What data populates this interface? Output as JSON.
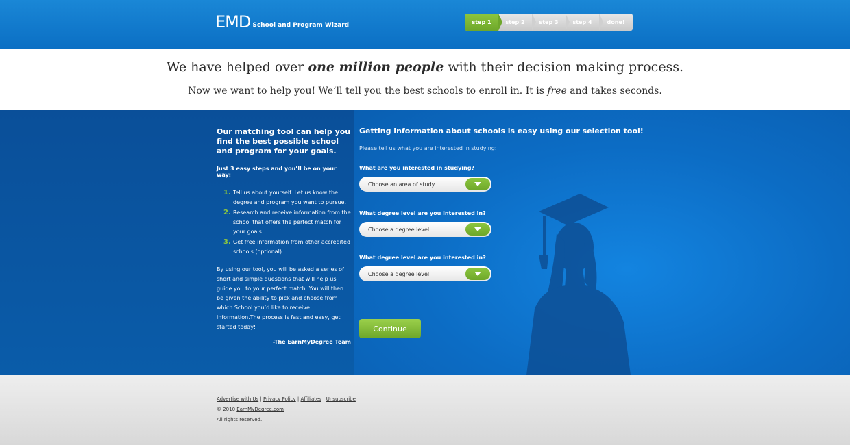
{
  "header": {
    "logo_mark": "EMD",
    "logo_subtitle": "School and Program Wizard",
    "steps": [
      "step 1",
      "step 2",
      "step 3",
      "step 4",
      "done!"
    ],
    "active_step": 1
  },
  "hero": {
    "line1_prefix": "We have helped over ",
    "line1_emph": "one million people",
    "line1_suffix": " with their decision making process.",
    "line2_prefix": "Now we want to help you! We’ll tell you the best schools to enroll in. It is ",
    "line2_emph": "free",
    "line2_suffix": " and takes seconds."
  },
  "left": {
    "heading": "Our matching tool can help you find the best possible school and program for your goals.",
    "subheading": "Just 3 easy steps and you’ll be on your way:",
    "steps": [
      {
        "num": "1.",
        "text": "Tell us about yourself. Let us know the degree and program you want to pursue."
      },
      {
        "num": "2.",
        "text": "Research and receive information from the school that offers the perfect match for your goals."
      },
      {
        "num": "3.",
        "text": "Get free information from other accredited schools (optional)."
      }
    ],
    "body": "By using our tool, you will be asked a series of short and simple questions that will help us guide you to your perfect match. You will then be given the ability to pick and choose from which School you’d like to receive information.The process is fast and easy, get started today!",
    "signature": "-The EarnMyDegree Team"
  },
  "form": {
    "heading": "Getting information about schools is easy using our selection tool!",
    "intro": "Please tell us what you are interested in studying:",
    "questions": [
      {
        "label": "What are you interested in studying?",
        "selected": "Choose an area of study"
      },
      {
        "label": "What degree level are you interested in?",
        "selected": "Choose a degree level"
      },
      {
        "label": "What degree level are you interested in?",
        "selected": "Choose a degree level"
      }
    ],
    "continue_label": "Continue"
  },
  "footer": {
    "links": [
      "Advertise with Us",
      "Privacy Policy",
      "Affiliates",
      "Unsubscribe"
    ],
    "separator": " | ",
    "copyright_prefix": "© 2010 ",
    "copyright_link": "EarnMyDegree.com",
    "rights": "All rights reserved."
  },
  "colors": {
    "header_blue": "#0b6fc4",
    "band_blue": "#0a60b2",
    "accent_green": "#8cc63f"
  }
}
